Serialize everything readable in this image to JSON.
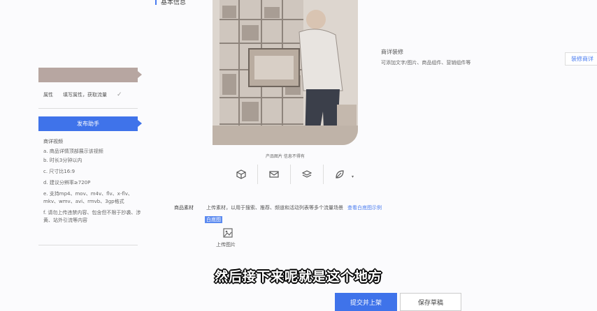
{
  "header": {
    "section_title": "基本信息"
  },
  "sidebar": {
    "step1_label": "",
    "row_attr": "属性",
    "row_attr_hint": "填写属性，获取流量",
    "step2_label": "发布助手",
    "tips_title": "商详视频",
    "tips": [
      "a. 商品详情顶部展示该视频",
      "b. 时长3分钟以内",
      "c. 尺寸比16:9",
      "d. 建议分辨率≥720P",
      "e. 支持mp4、mov、m4v、flv、x-flv、mkv、wmv、avi、rmvb、3gp格式",
      "f. 请勿上传违禁内容、包含但不限于抄袭、涉黄、站外引流等内容"
    ]
  },
  "product": {
    "image_caption": "产品图片 信息不得有",
    "toolbar_icons": [
      "box-icon",
      "envelope-icon",
      "layers-icon",
      "leaf-icon"
    ],
    "toolbar_caret": "▾"
  },
  "detail": {
    "title": "商详装修",
    "desc": "可添加文字/图片、商品组件、营销组件等",
    "decorate_button": "装修商详"
  },
  "material": {
    "label": "商品素材",
    "desc": "上传素材，以用于搜索、推荐、频道和活动列表等多个流量场景",
    "link": "查看白底图示例",
    "tutorial": "白底图",
    "upload_label": "上传图片"
  },
  "subtitle": "然后接下来呢就是这个地方",
  "footer": {
    "submit": "提交并上架",
    "draft": "保存草稿"
  },
  "colors": {
    "accent": "#3f73ea",
    "step_done": "#b7a6a1"
  }
}
